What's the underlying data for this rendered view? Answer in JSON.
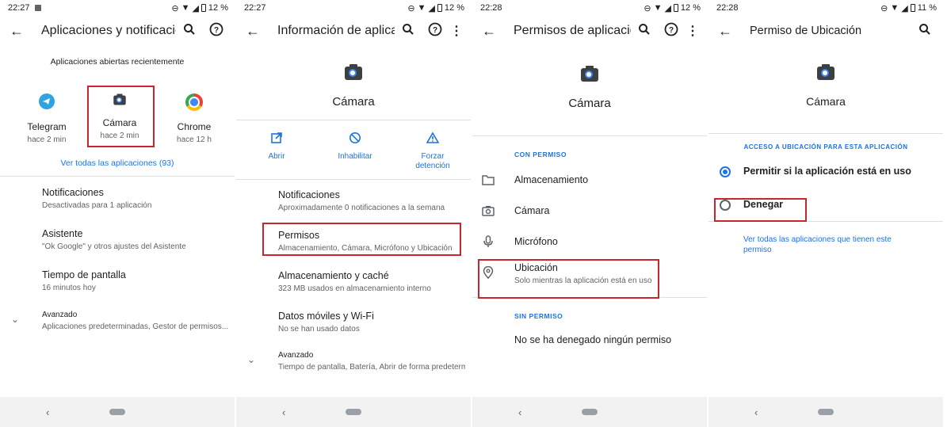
{
  "panels": [
    {
      "status": {
        "time": "22:27",
        "battery": "12 %"
      },
      "title": "Aplicaciones y notificaciones",
      "recent_header": "Aplicaciones abiertas recientemente",
      "recent_apps": [
        {
          "name": "Telegram",
          "time": "hace 2 min"
        },
        {
          "name": "Cámara",
          "time": "hace 2 min"
        },
        {
          "name": "Chrome",
          "time": "hace 12 h"
        }
      ],
      "see_all": "Ver todas las aplicaciones (93)",
      "items": [
        {
          "title": "Notificaciones",
          "sub": "Desactivadas para 1 aplicación"
        },
        {
          "title": "Asistente",
          "sub": "\"Ok Google\" y otros ajustes del Asistente"
        },
        {
          "title": "Tiempo de pantalla",
          "sub": "16 minutos hoy"
        },
        {
          "title": "Avanzado",
          "sub": "Aplicaciones predeterminadas, Gestor de permisos..."
        }
      ]
    },
    {
      "status": {
        "time": "22:27",
        "battery": "12 %"
      },
      "title": "Información de aplicaciones",
      "app_name": "Cámara",
      "actions": [
        {
          "label": "Abrir"
        },
        {
          "label": "Inhabilitar"
        },
        {
          "label": "Forzar detención"
        }
      ],
      "items": [
        {
          "title": "Notificaciones",
          "sub": "Aproximadamente 0 notificaciones a la semana"
        },
        {
          "title": "Permisos",
          "sub": "Almacenamiento, Cámara, Micrófono y Ubicación"
        },
        {
          "title": "Almacenamiento y caché",
          "sub": "323 MB usados en almacenamiento interno"
        },
        {
          "title": "Datos móviles y Wi-Fi",
          "sub": "No se han usado datos"
        },
        {
          "title": "Avanzado",
          "sub": "Tiempo de pantalla, Batería, Abrir de forma predeterminada"
        }
      ]
    },
    {
      "status": {
        "time": "22:28",
        "battery": "12 %"
      },
      "title": "Permisos de aplicaciones",
      "app_name": "Cámara",
      "allowed_header": "CON PERMISO",
      "allowed": [
        {
          "title": "Almacenamiento",
          "sub": ""
        },
        {
          "title": "Cámara",
          "sub": ""
        },
        {
          "title": "Micrófono",
          "sub": ""
        },
        {
          "title": "Ubicación",
          "sub": "Solo mientras la aplicación está en uso"
        }
      ],
      "denied_header": "SIN PERMISO",
      "denied_text": "No se ha denegado ningún permiso"
    },
    {
      "status": {
        "time": "22:28",
        "battery": "11 %"
      },
      "title": "Permiso de Ubicación",
      "app_name": "Cámara",
      "section_header": "ACCESO A UBICACIÓN PARA ESTA APLICACIÓN",
      "options": [
        {
          "label": "Permitir si la aplicación está en uso",
          "selected": true
        },
        {
          "label": "Denegar",
          "selected": false
        }
      ],
      "see_all_link": "Ver todas las aplicaciones que tienen este permiso"
    }
  ],
  "colors": {
    "accent": "#1a73e8",
    "highlight": "#c6262e",
    "navbar": "#f2f2f2"
  }
}
